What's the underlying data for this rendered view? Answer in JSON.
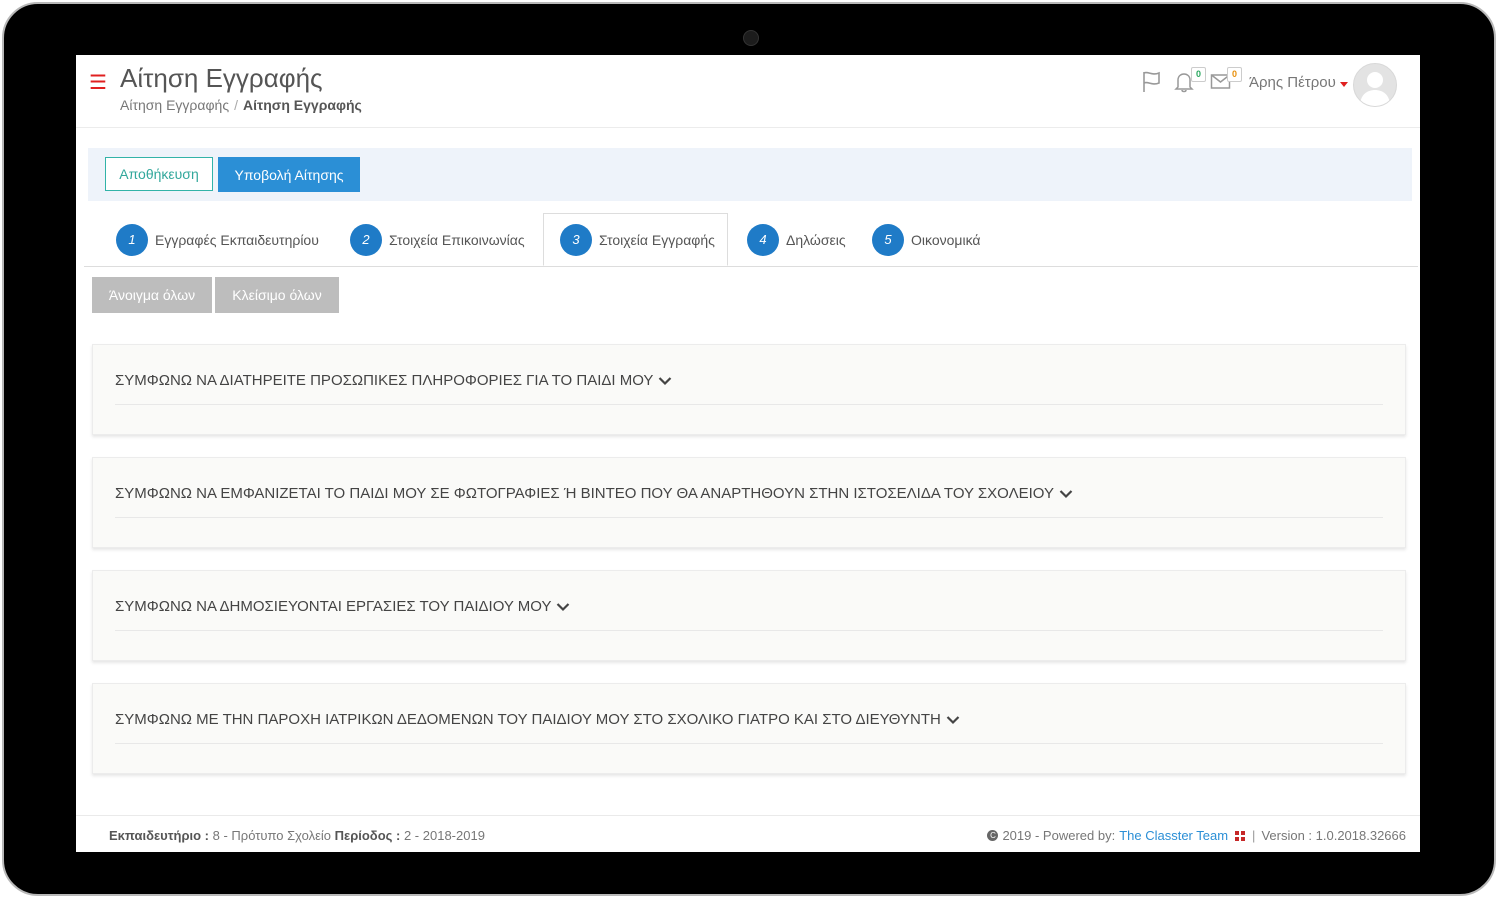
{
  "header": {
    "title": "Αίτηση Εγγραφής",
    "breadcrumb": [
      "Αίτηση Εγγραφής",
      "Αίτηση Εγγραφής"
    ],
    "breadcrumb_sep": "/",
    "notifications_count": "0",
    "messages_count": "0",
    "user_name": "Άρης Πέτρου"
  },
  "actions": {
    "save_label": "Αποθήκευση",
    "submit_label": "Υποβολή Αίτησης"
  },
  "tabs": [
    {
      "num": "1",
      "label": "Εγγραφές Εκπαιδευτηρίου"
    },
    {
      "num": "2",
      "label": "Στοιχεία Επικοινωνίας"
    },
    {
      "num": "3",
      "label": "Στοιχεία Εγγραφής"
    },
    {
      "num": "4",
      "label": "Δηλώσεις"
    },
    {
      "num": "5",
      "label": "Οικονομικά"
    }
  ],
  "toolbar": {
    "expand_all": "Άνοιγμα όλων",
    "collapse_all": "Κλείσιμο όλων"
  },
  "panels": [
    {
      "title": "ΣΥΜΦΩΝΩ ΝΑ ΔΙΑΤΗΡΕΙΤΕ ΠΡΟΣΩΠΙΚΕΣ ΠΛΗΡΟΦΟΡΙΕΣ ΓΙΑ ΤΟ ΠΑΙΔΙ ΜΟΥ"
    },
    {
      "title": "ΣΥΜΦΩΝΩ ΝΑ ΕΜΦΑΝΙΖΕΤΑΙ ΤΟ ΠΑΙΔΙ ΜΟΥ ΣΕ ΦΩΤΟΓΡΑΦΙΕΣ Ή ΒΙΝΤΕΟ ΠΟΥ ΘΑ ΑΝΑΡΤΗΘΟΥΝ ΣΤΗΝ ΙΣΤΟΣΕΛΙΔΑ ΤΟΥ ΣΧΟΛΕΙΟΥ"
    },
    {
      "title": "ΣΥΜΦΩΝΩ ΝΑ ΔΗΜΟΣΙΕΥΟΝΤΑΙ ΕΡΓΑΣΙΕΣ ΤΟΥ ΠΑΙΔΙΟΥ ΜΟΥ"
    },
    {
      "title": "ΣΥΜΦΩΝΩ ΜΕ ΤΗΝ ΠΑΡΟΧΗ ΙΑΤΡΙΚΩΝ ΔΕΔΟΜΕΝΩΝ ΤΟΥ ΠΑΙΔΙΟΥ ΜΟΥ ΣΤΟ ΣΧΟΛΙΚΟ ΓΙΑΤΡΟ ΚΑΙ ΣΤΟ ΔΙΕΥΘΥΝΤΗ"
    }
  ],
  "footer": {
    "school_label": "Εκπαιδευτήριο :",
    "school_value": "8 - Πρότυπο Σχολείο",
    "period_label": "Περίοδος :",
    "period_value": "2 - 2018-2019",
    "powered_text": "2019 - Powered by:",
    "powered_link": "The Classter Team",
    "separator": "|",
    "version": "Version : 1.0.2018.32666"
  },
  "colors": {
    "accent": "#2b8fd6",
    "tab_badge": "#1f7bc7",
    "save_border": "#32b3a8",
    "hamburger": "#e02020"
  },
  "icons": [
    "hamburger-icon",
    "flag-icon",
    "bell-icon",
    "envelope-icon",
    "user-caret-icon",
    "avatar-icon",
    "chevron-down-icon",
    "copyright-icon",
    "classter-logo-icon"
  ]
}
